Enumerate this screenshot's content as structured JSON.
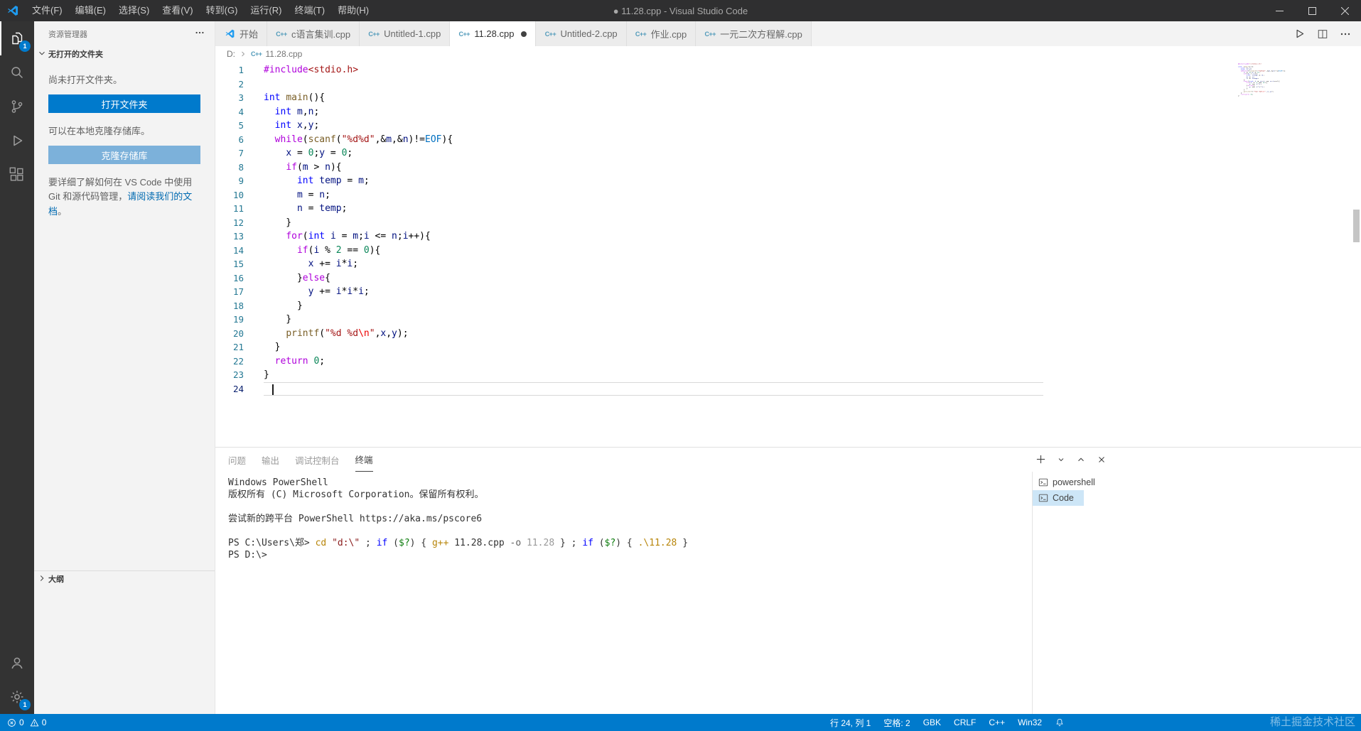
{
  "title_bar": {
    "app_title": "● 11.28.cpp - Visual Studio Code",
    "menus": [
      "文件(F)",
      "编辑(E)",
      "选择(S)",
      "查看(V)",
      "转到(G)",
      "运行(R)",
      "终端(T)",
      "帮助(H)"
    ]
  },
  "activity_bar": {
    "items": [
      {
        "name": "explorer",
        "badge": "1",
        "active": true
      },
      {
        "name": "search"
      },
      {
        "name": "source-control"
      },
      {
        "name": "run-debug"
      },
      {
        "name": "extensions"
      }
    ],
    "bottom_items": [
      {
        "name": "account"
      },
      {
        "name": "settings",
        "badge": "1"
      }
    ]
  },
  "sidebar": {
    "title": "资源管理器",
    "section_title": "无打开的文件夹",
    "empty_text": "尚未打开文件夹。",
    "open_folder_button": "打开文件夹",
    "clone_hint": "可以在本地克隆存储库。",
    "clone_button": "克隆存储库",
    "docs_text_before": "要详细了解如何在 VS Code 中使用 Git 和源代码管理，",
    "docs_link": "请阅读我们的文档",
    "docs_text_after": "。",
    "outline_section": "大纲"
  },
  "editor": {
    "tabs": [
      {
        "label": "开始",
        "icon": "vscode"
      },
      {
        "label": "c语言集训.cpp",
        "icon": "cpp"
      },
      {
        "label": "Untitled-1.cpp",
        "icon": "cpp"
      },
      {
        "label": "11.28.cpp",
        "icon": "cpp",
        "active": true,
        "modified": true
      },
      {
        "label": "Untitled-2.cpp",
        "icon": "cpp"
      },
      {
        "label": "作业.cpp",
        "icon": "cpp"
      },
      {
        "label": "一元二次方程解.cpp",
        "icon": "cpp"
      }
    ],
    "breadcrumbs": [
      "D:",
      "11.28.cpp"
    ],
    "active_line": 24,
    "syntax_colors": {
      "kw": "#af00db",
      "type": "#0000ff",
      "fn": "#795e26",
      "var": "#001080",
      "num": "#098658",
      "str": "#a31515",
      "esc": "#ee0000",
      "cst": "#0070c1",
      "pl": "#000000"
    },
    "code_lines": [
      [
        {
          "c": "kw",
          "t": "#include"
        },
        {
          "c": "str",
          "t": "<stdio.h>"
        }
      ],
      [],
      [
        {
          "c": "type",
          "t": "int"
        },
        {
          "c": "pl",
          "t": " "
        },
        {
          "c": "fn",
          "t": "main"
        },
        {
          "c": "pl",
          "t": "(){"
        }
      ],
      [
        {
          "c": "pl",
          "t": "  "
        },
        {
          "c": "type",
          "t": "int"
        },
        {
          "c": "pl",
          "t": " "
        },
        {
          "c": "var",
          "t": "m"
        },
        {
          "c": "pl",
          "t": ","
        },
        {
          "c": "var",
          "t": "n"
        },
        {
          "c": "pl",
          "t": ";"
        }
      ],
      [
        {
          "c": "pl",
          "t": "  "
        },
        {
          "c": "type",
          "t": "int"
        },
        {
          "c": "pl",
          "t": " "
        },
        {
          "c": "var",
          "t": "x"
        },
        {
          "c": "pl",
          "t": ","
        },
        {
          "c": "var",
          "t": "y"
        },
        {
          "c": "pl",
          "t": ";"
        }
      ],
      [
        {
          "c": "pl",
          "t": "  "
        },
        {
          "c": "kw",
          "t": "while"
        },
        {
          "c": "pl",
          "t": "("
        },
        {
          "c": "fn",
          "t": "scanf"
        },
        {
          "c": "pl",
          "t": "("
        },
        {
          "c": "str",
          "t": "\"%d%d\""
        },
        {
          "c": "pl",
          "t": ",&"
        },
        {
          "c": "var",
          "t": "m"
        },
        {
          "c": "pl",
          "t": ",&"
        },
        {
          "c": "var",
          "t": "n"
        },
        {
          "c": "pl",
          "t": ")!="
        },
        {
          "c": "cst",
          "t": "EOF"
        },
        {
          "c": "pl",
          "t": "){"
        }
      ],
      [
        {
          "c": "pl",
          "t": "    "
        },
        {
          "c": "var",
          "t": "x"
        },
        {
          "c": "pl",
          "t": " = "
        },
        {
          "c": "num",
          "t": "0"
        },
        {
          "c": "pl",
          "t": ";"
        },
        {
          "c": "var",
          "t": "y"
        },
        {
          "c": "pl",
          "t": " = "
        },
        {
          "c": "num",
          "t": "0"
        },
        {
          "c": "pl",
          "t": ";"
        }
      ],
      [
        {
          "c": "pl",
          "t": "    "
        },
        {
          "c": "kw",
          "t": "if"
        },
        {
          "c": "pl",
          "t": "("
        },
        {
          "c": "var",
          "t": "m"
        },
        {
          "c": "pl",
          "t": " > "
        },
        {
          "c": "var",
          "t": "n"
        },
        {
          "c": "pl",
          "t": "){"
        }
      ],
      [
        {
          "c": "pl",
          "t": "      "
        },
        {
          "c": "type",
          "t": "int"
        },
        {
          "c": "pl",
          "t": " "
        },
        {
          "c": "var",
          "t": "temp"
        },
        {
          "c": "pl",
          "t": " = "
        },
        {
          "c": "var",
          "t": "m"
        },
        {
          "c": "pl",
          "t": ";"
        }
      ],
      [
        {
          "c": "pl",
          "t": "      "
        },
        {
          "c": "var",
          "t": "m"
        },
        {
          "c": "pl",
          "t": " = "
        },
        {
          "c": "var",
          "t": "n"
        },
        {
          "c": "pl",
          "t": ";"
        }
      ],
      [
        {
          "c": "pl",
          "t": "      "
        },
        {
          "c": "var",
          "t": "n"
        },
        {
          "c": "pl",
          "t": " = "
        },
        {
          "c": "var",
          "t": "temp"
        },
        {
          "c": "pl",
          "t": ";"
        }
      ],
      [
        {
          "c": "pl",
          "t": "    }"
        }
      ],
      [
        {
          "c": "pl",
          "t": "    "
        },
        {
          "c": "kw",
          "t": "for"
        },
        {
          "c": "pl",
          "t": "("
        },
        {
          "c": "type",
          "t": "int"
        },
        {
          "c": "pl",
          "t": " "
        },
        {
          "c": "var",
          "t": "i"
        },
        {
          "c": "pl",
          "t": " = "
        },
        {
          "c": "var",
          "t": "m"
        },
        {
          "c": "pl",
          "t": ";"
        },
        {
          "c": "var",
          "t": "i"
        },
        {
          "c": "pl",
          "t": " <= "
        },
        {
          "c": "var",
          "t": "n"
        },
        {
          "c": "pl",
          "t": ";"
        },
        {
          "c": "var",
          "t": "i"
        },
        {
          "c": "pl",
          "t": "++){"
        }
      ],
      [
        {
          "c": "pl",
          "t": "      "
        },
        {
          "c": "kw",
          "t": "if"
        },
        {
          "c": "pl",
          "t": "("
        },
        {
          "c": "var",
          "t": "i"
        },
        {
          "c": "pl",
          "t": " % "
        },
        {
          "c": "num",
          "t": "2"
        },
        {
          "c": "pl",
          "t": " == "
        },
        {
          "c": "num",
          "t": "0"
        },
        {
          "c": "pl",
          "t": "){"
        }
      ],
      [
        {
          "c": "pl",
          "t": "        "
        },
        {
          "c": "var",
          "t": "x"
        },
        {
          "c": "pl",
          "t": " += "
        },
        {
          "c": "var",
          "t": "i"
        },
        {
          "c": "pl",
          "t": "*"
        },
        {
          "c": "var",
          "t": "i"
        },
        {
          "c": "pl",
          "t": ";"
        }
      ],
      [
        {
          "c": "pl",
          "t": "      }"
        },
        {
          "c": "kw",
          "t": "else"
        },
        {
          "c": "pl",
          "t": "{"
        }
      ],
      [
        {
          "c": "pl",
          "t": "        "
        },
        {
          "c": "var",
          "t": "y"
        },
        {
          "c": "pl",
          "t": " += "
        },
        {
          "c": "var",
          "t": "i"
        },
        {
          "c": "pl",
          "t": "*"
        },
        {
          "c": "var",
          "t": "i"
        },
        {
          "c": "pl",
          "t": "*"
        },
        {
          "c": "var",
          "t": "i"
        },
        {
          "c": "pl",
          "t": ";"
        }
      ],
      [
        {
          "c": "pl",
          "t": "      }"
        }
      ],
      [
        {
          "c": "pl",
          "t": "    }"
        }
      ],
      [
        {
          "c": "pl",
          "t": "    "
        },
        {
          "c": "fn",
          "t": "printf"
        },
        {
          "c": "pl",
          "t": "("
        },
        {
          "c": "str",
          "t": "\"%d %d"
        },
        {
          "c": "esc",
          "t": "\\n"
        },
        {
          "c": "str",
          "t": "\""
        },
        {
          "c": "pl",
          "t": ","
        },
        {
          "c": "var",
          "t": "x"
        },
        {
          "c": "pl",
          "t": ","
        },
        {
          "c": "var",
          "t": "y"
        },
        {
          "c": "pl",
          "t": ");"
        }
      ],
      [
        {
          "c": "pl",
          "t": "  }"
        }
      ],
      [
        {
          "c": "pl",
          "t": "  "
        },
        {
          "c": "kw",
          "t": "return"
        },
        {
          "c": "pl",
          "t": " "
        },
        {
          "c": "num",
          "t": "0"
        },
        {
          "c": "pl",
          "t": ";"
        }
      ],
      [
        {
          "c": "pl",
          "t": "}"
        }
      ],
      []
    ]
  },
  "panel": {
    "tabs": [
      {
        "label": "问题"
      },
      {
        "label": "输出"
      },
      {
        "label": "调试控制台"
      },
      {
        "label": "终端",
        "active": true
      }
    ],
    "terminal": {
      "colors": {
        "tp": "#333333",
        "cmd": "#b8860b",
        "str": "#8b1d1d",
        "kw": "#0000ff",
        "var": "#0e7d0e",
        "prm": "#5f5f5f",
        "num": "#9a9a9a"
      },
      "lines": [
        [
          {
            "c": "tp",
            "t": "Windows PowerShell"
          }
        ],
        [
          {
            "c": "tp",
            "t": "版权所有 (C) Microsoft Corporation。保留所有权利。"
          }
        ],
        [],
        [
          {
            "c": "tp",
            "t": "尝试新的跨平台 PowerShell https://aka.ms/pscore6"
          }
        ],
        [],
        [
          {
            "c": "tp",
            "t": "PS C:\\Users\\郑> "
          },
          {
            "c": "cmd",
            "t": "cd"
          },
          {
            "c": "tp",
            "t": " "
          },
          {
            "c": "str",
            "t": "\"d:\\\""
          },
          {
            "c": "tp",
            "t": " ; "
          },
          {
            "c": "kw",
            "t": "if"
          },
          {
            "c": "tp",
            "t": " ("
          },
          {
            "c": "var",
            "t": "$?"
          },
          {
            "c": "tp",
            "t": ") { "
          },
          {
            "c": "cmd",
            "t": "g++"
          },
          {
            "c": "tp",
            "t": " 11.28.cpp "
          },
          {
            "c": "prm",
            "t": "-o"
          },
          {
            "c": "tp",
            "t": " "
          },
          {
            "c": "num",
            "t": "11.28"
          },
          {
            "c": "tp",
            "t": " } ; "
          },
          {
            "c": "kw",
            "t": "if"
          },
          {
            "c": "tp",
            "t": " ("
          },
          {
            "c": "var",
            "t": "$?"
          },
          {
            "c": "tp",
            "t": ") { "
          },
          {
            "c": "cmd",
            "t": ".\\11.28"
          },
          {
            "c": "tp",
            "t": " }"
          }
        ],
        [
          {
            "c": "tp",
            "t": "PS D:\\>"
          }
        ]
      ],
      "list": [
        {
          "label": "powershell",
          "selected": false
        },
        {
          "label": "Code",
          "selected": true
        }
      ]
    }
  },
  "status_bar": {
    "errors": "0",
    "warnings": "0",
    "line_col": "行 24, 列 1",
    "indent": "空格: 2",
    "encoding": "GBK",
    "eol": "CRLF",
    "language": "C++",
    "platform": "Win32"
  },
  "watermark": {
    "text": "稀土掘金技术社区"
  }
}
